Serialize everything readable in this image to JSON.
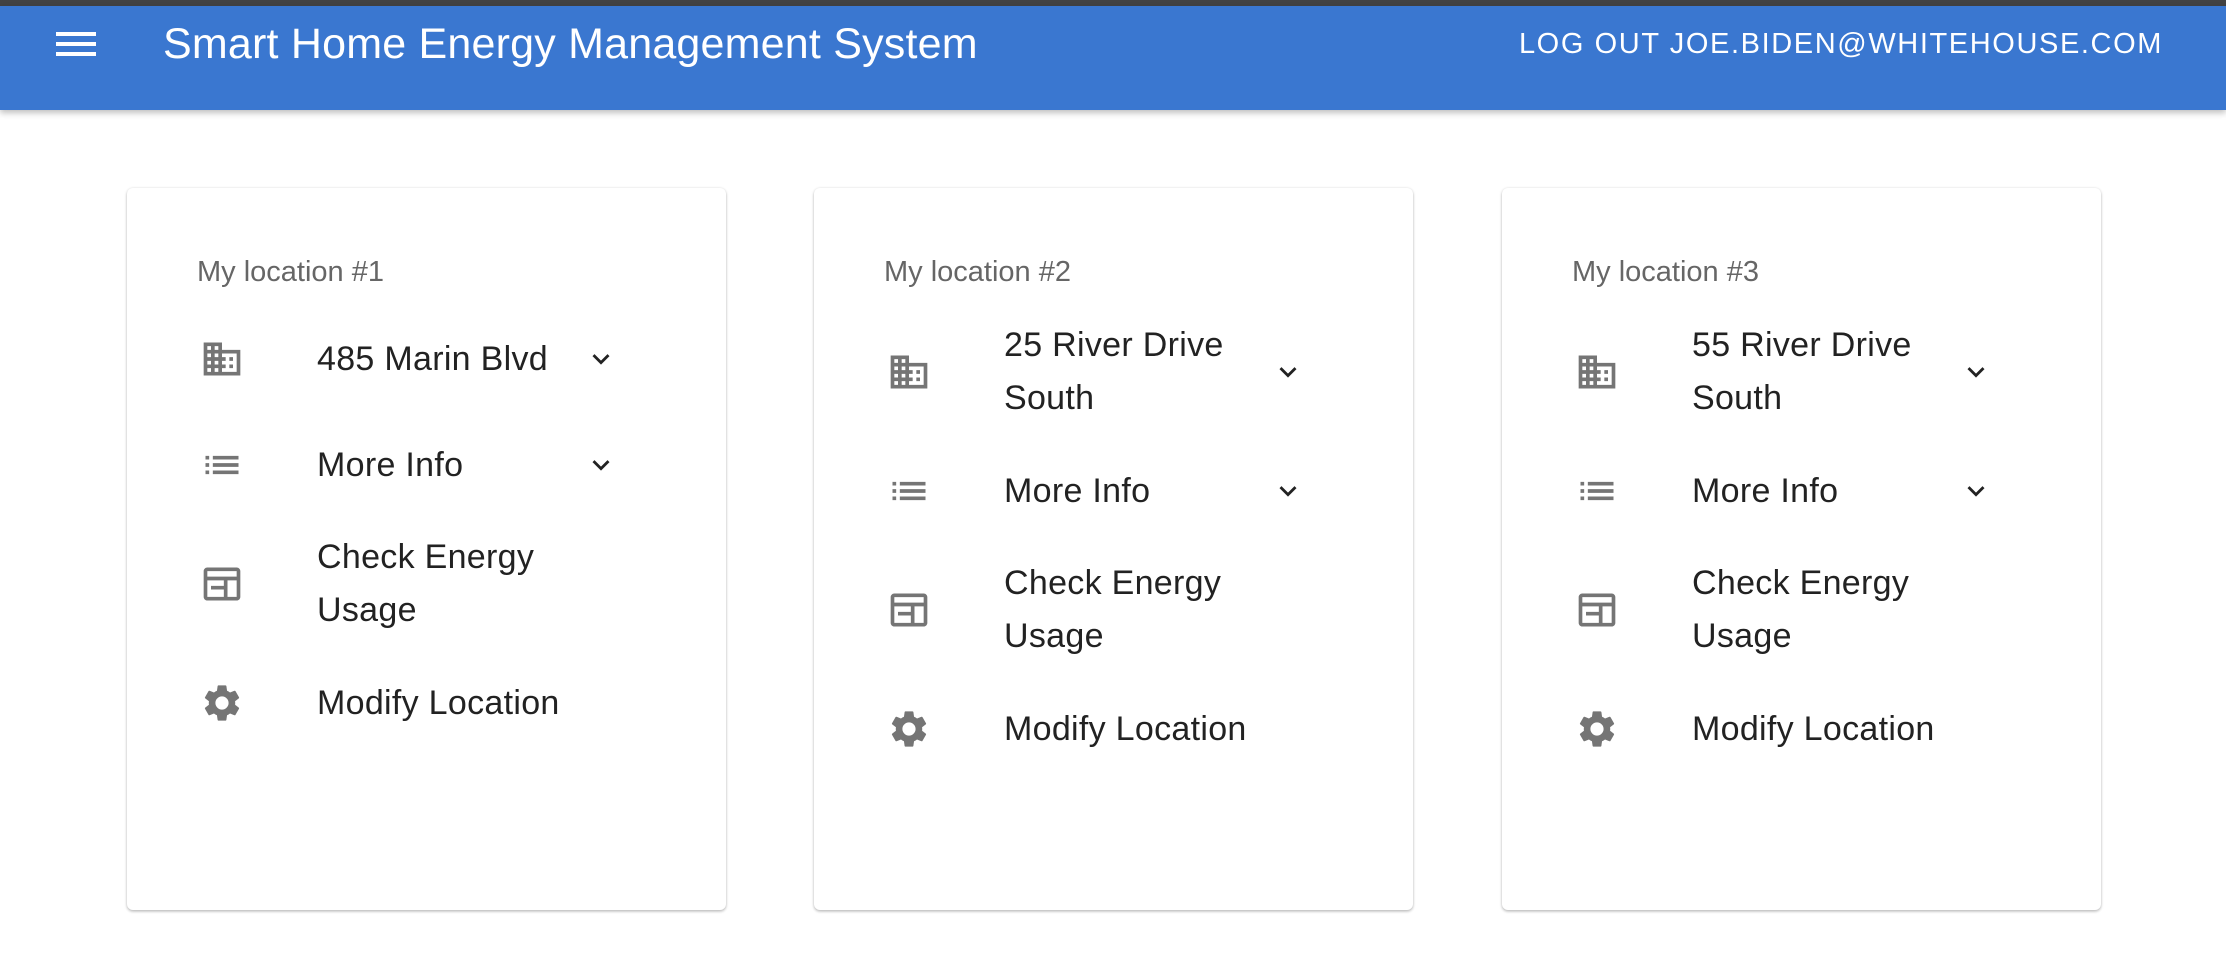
{
  "header": {
    "title": "Smart Home Energy Management System",
    "logout_label": "LOG OUT JOE.BIDEN@WHITEHOUSE.COM"
  },
  "colors": {
    "appbar": "#3a77d0",
    "icon": "#757575",
    "text": "#222222",
    "subtitle": "#666666"
  },
  "locations": [
    {
      "title": "My location #1",
      "address": "485 Marin Blvd",
      "more_info": "More Info",
      "check_energy": "Check Energy Usage",
      "modify": "Modify Location"
    },
    {
      "title": "My location #2",
      "address": "25 River Drive South",
      "more_info": "More Info",
      "check_energy": "Check Energy Usage",
      "modify": "Modify Location"
    },
    {
      "title": "My location #3",
      "address": "55 River Drive South",
      "more_info": "More Info",
      "check_energy": "Check Energy Usage",
      "modify": "Modify Location"
    }
  ],
  "icons": {
    "menu": "menu-icon",
    "address": "building-icon",
    "more_info": "list-icon",
    "check_energy": "dashboard-icon",
    "modify": "gear-icon",
    "expand": "chevron-down-icon"
  }
}
